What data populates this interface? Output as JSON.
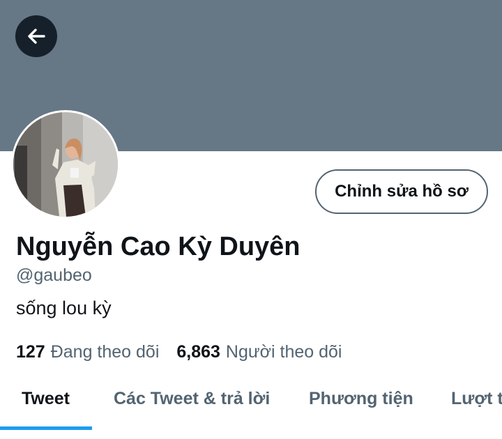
{
  "header": {
    "back_icon": "arrow-left-icon",
    "banner_color": "#667786"
  },
  "profile": {
    "avatar_icon": "avatar-photo",
    "edit_label": "Chỉnh sửa hồ sơ",
    "display_name": "Nguyễn Cao Kỳ Duyên",
    "handle": "@gaubeo",
    "bio": "sống lou kỳ",
    "following_count": "127",
    "following_label": "Đang theo dõi",
    "followers_count": "6,863",
    "followers_label": "Người theo dõi"
  },
  "tabs": [
    {
      "label": "Tweet",
      "active": true
    },
    {
      "label": "Các Tweet & trả lời",
      "active": false
    },
    {
      "label": "Phương tiện",
      "active": false
    },
    {
      "label": "Lượt thích",
      "active": false
    }
  ],
  "colors": {
    "accent": "#1d9bf0",
    "text_primary": "#0f1419",
    "text_secondary": "#536471"
  }
}
